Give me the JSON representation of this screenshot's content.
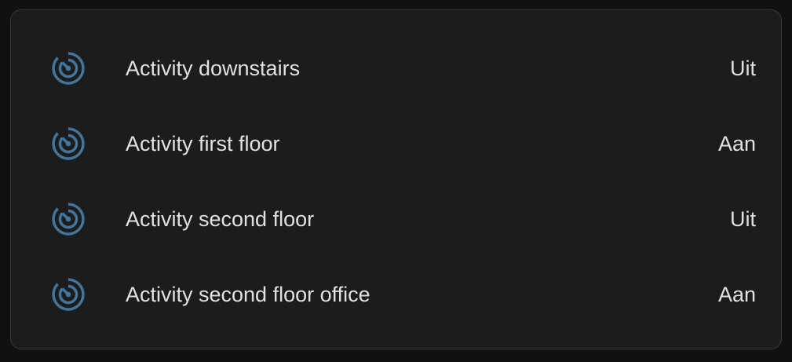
{
  "colors": {
    "background": "#111111",
    "card": "#1c1c1c",
    "card_border": "#3a3a3a",
    "text": "#e1e1e1",
    "icon": "#44739e"
  },
  "entities": [
    {
      "icon": "motion-sensor-icon",
      "name": "Activity downstairs",
      "state": "Uit"
    },
    {
      "icon": "motion-sensor-icon",
      "name": "Activity first floor",
      "state": "Aan"
    },
    {
      "icon": "motion-sensor-icon",
      "name": "Activity second floor",
      "state": "Uit"
    },
    {
      "icon": "motion-sensor-icon",
      "name": "Activity second floor office",
      "state": "Aan"
    }
  ]
}
